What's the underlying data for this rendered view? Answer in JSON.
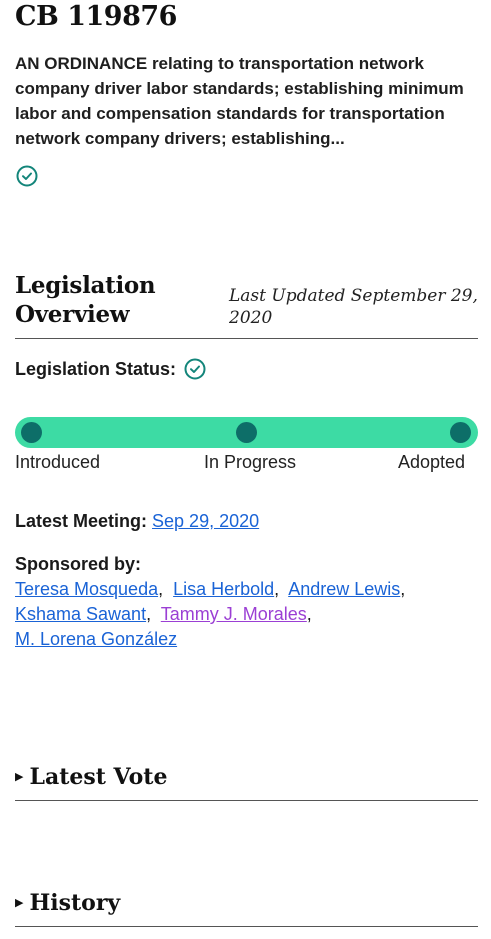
{
  "bill": {
    "number": "CB 119876",
    "summary": "AN ORDINANCE relating to transportation network company driver labor standards; establishing minimum labor and compensation standards for transportation network company drivers; establishing..."
  },
  "overview": {
    "title": "Legislation Overview",
    "last_updated": "Last Updated September 29, 2020",
    "status_label": "Legislation Status:",
    "stages": [
      "Introduced",
      "In Progress",
      "Adopted"
    ],
    "progress_fraction": 1.0,
    "latest_meeting_label": "Latest Meeting:",
    "latest_meeting_date": "Sep 29, 2020",
    "sponsored_by_label": "Sponsored by:",
    "sponsors": [
      "Teresa Mosqueda",
      "Lisa Herbold",
      "Andrew Lewis",
      "Kshama Sawant",
      "Tammy J. Morales",
      "M. Lorena González"
    ]
  },
  "sections": {
    "latest_vote": "Latest Vote",
    "history": "History"
  },
  "colors": {
    "progress_track": "#3ddba4",
    "progress_dot": "#0d6e68",
    "link": "#1a63d6",
    "visited_link": "#9b3fd4",
    "check_icon": "#13857a"
  }
}
